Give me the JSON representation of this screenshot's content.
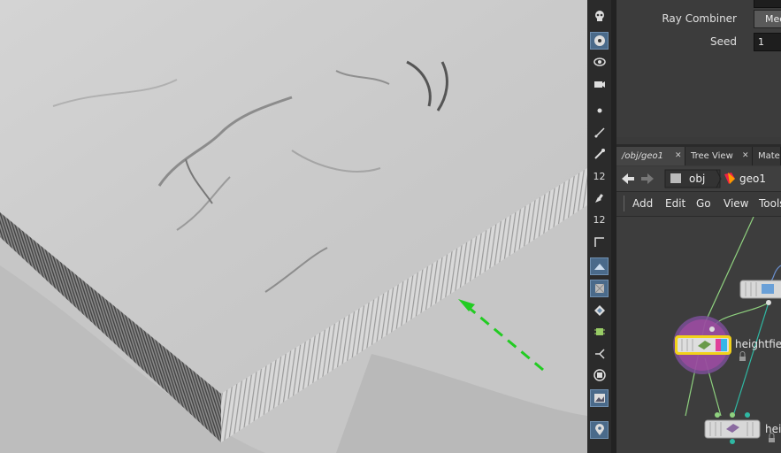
{
  "viewport": {
    "annotation_arrow_color": "#22cc22"
  },
  "toolbar": {
    "tools": [
      {
        "icon": "skull-icon"
      },
      {
        "icon": "select-icon"
      },
      {
        "icon": "view-icon"
      },
      {
        "icon": "camera-icon"
      },
      {
        "icon": "point-icon"
      },
      {
        "icon": "edge-icon"
      },
      {
        "icon": "pin-icon"
      },
      {
        "icon": "snap-12-icon",
        "text": "12"
      },
      {
        "icon": "brush-icon"
      },
      {
        "icon": "snap-12b-icon",
        "text": "12"
      },
      {
        "icon": "corner-icon"
      },
      {
        "icon": "shaded-icon"
      },
      {
        "icon": "texture-icon"
      },
      {
        "icon": "diamond-icon"
      },
      {
        "icon": "bug-icon"
      },
      {
        "icon": "branch-icon"
      },
      {
        "icon": "record-icon"
      },
      {
        "icon": "image-icon"
      },
      {
        "icon": "location-icon"
      }
    ]
  },
  "params": {
    "ray_combiner_label": "Ray Combiner",
    "ray_combiner_value": "Med",
    "seed_label": "Seed",
    "seed_value": "1"
  },
  "tabs": [
    {
      "label": "/obj/geo1"
    },
    {
      "label": "Tree View"
    },
    {
      "label": "Mater"
    }
  ],
  "pathbar": {
    "obj": "obj",
    "geo": "geo1"
  },
  "menus": [
    "Add",
    "Edit",
    "Go",
    "View",
    "Tools"
  ],
  "network": {
    "node_main_label": "heightfie",
    "node_bottom_label": "hei",
    "selected_color": "#f2d21b",
    "wire_color": "#8fd17f",
    "wire_color_teal": "#2fb8a3"
  }
}
